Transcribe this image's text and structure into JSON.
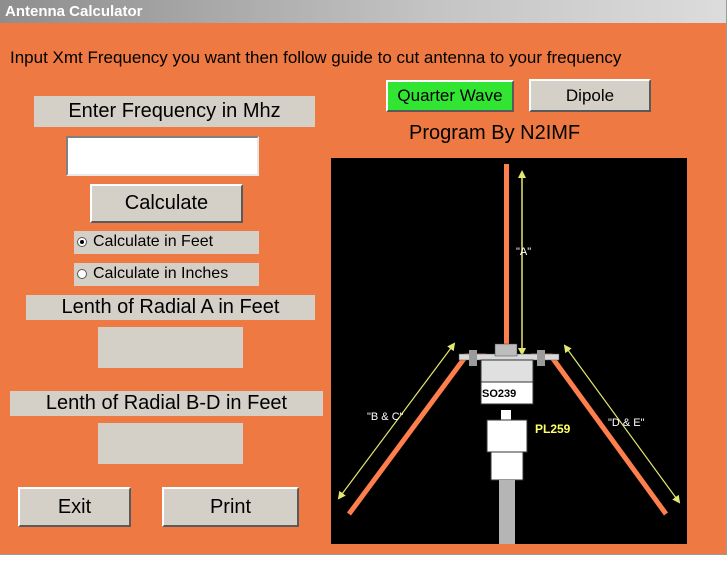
{
  "window": {
    "title": "Antenna Calculator"
  },
  "instructions": "Input Xmt Frequency you want then follow guide to cut antenna to your frequency",
  "frequency": {
    "label": "Enter Frequency in Mhz",
    "value": ""
  },
  "calculate_button": "Calculate",
  "units": {
    "feet_label": "Calculate in Feet",
    "inches_label": "Calculate in Inches",
    "selected": "feet"
  },
  "radial_a": {
    "label": "Lenth of Radial A in Feet",
    "value": ""
  },
  "radial_bd": {
    "label": "Lenth of Radial B-D in Feet",
    "value": ""
  },
  "exit_button": "Exit",
  "print_button": "Print",
  "mode": {
    "quarter_wave": "Quarter Wave",
    "dipole": "Dipole",
    "selected": "quarter_wave"
  },
  "credit": "Program By N2IMF",
  "diagram": {
    "label_a": "\"A\"",
    "label_bc": "\"B & C\"",
    "label_de": "\"D & E\"",
    "so239": "SO239",
    "pl259": "PL259"
  },
  "colors": {
    "background": "#ee7942",
    "control": "#d4d0c8",
    "active_mode": "#33e533",
    "element": "#ff7e4d",
    "arrow": "#e6e673"
  }
}
